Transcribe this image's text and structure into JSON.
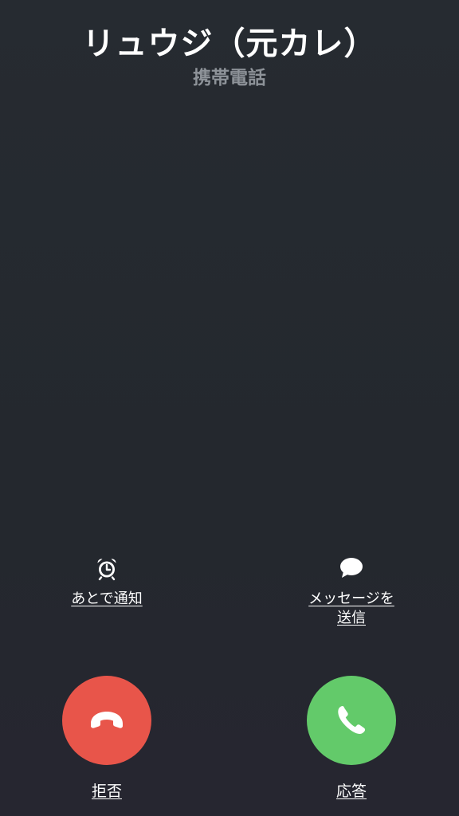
{
  "caller": {
    "name": "リュウジ（元カレ）",
    "subtitle": "携帯電話"
  },
  "actions": {
    "remind": {
      "label": "あとで通知",
      "icon": "alarm-clock-icon"
    },
    "message": {
      "label_line1": "メッセージを",
      "label_line2": "送信",
      "icon": "speech-bubble-icon"
    }
  },
  "buttons": {
    "decline": {
      "label": "拒否",
      "icon": "phone-hangup-icon",
      "color": "#e8554a"
    },
    "accept": {
      "label": "応答",
      "icon": "phone-icon",
      "color": "#63ca6a"
    }
  },
  "theme": {
    "background": "#262b31",
    "subtitle_color": "#8e9399"
  }
}
